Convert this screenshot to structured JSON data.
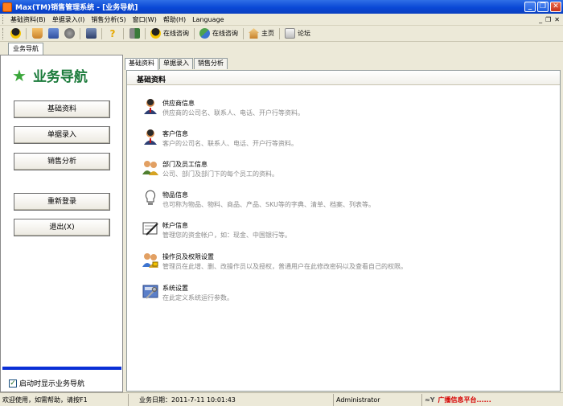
{
  "window": {
    "title": "Max(TM)销售管理系统 - [业务导航]"
  },
  "menu": {
    "items": [
      "基础资料(B)",
      "单据录入(I)",
      "销售分析(S)",
      "窗口(W)",
      "帮助(H)",
      "Language"
    ],
    "right_controls": [
      "_",
      "❐",
      "✕"
    ]
  },
  "toolbar": {
    "consult1": "在线咨询",
    "consult2": "在线咨询",
    "home": "主页",
    "forum": "论坛"
  },
  "doc_tab": "业务导航",
  "nav": {
    "title": "业务导航",
    "buttons": [
      "基础资料",
      "单据录入",
      "销售分析",
      "重新登录",
      "退出(X)"
    ],
    "startup_label": "启动时显示业务导航",
    "startup_checked": "✓"
  },
  "tabs": [
    "基础资料",
    "单据录入",
    "销售分析"
  ],
  "content": {
    "header": "基础资料",
    "entries": [
      {
        "title": "供应商信息",
        "desc": "供应商的公司名、联系人、电话、开户行等资料。",
        "icon": "supplier-person-icon"
      },
      {
        "title": "客户信息",
        "desc": "客户的公司名、联系人、电话、开户行等资料。",
        "icon": "customer-person-icon"
      },
      {
        "title": "部门及员工信息",
        "desc": "公司、部门及部门下的每个员工的资料。",
        "icon": "department-people-icon"
      },
      {
        "title": "物品信息",
        "desc": "也可称为物品、物料、商品、产品、SKU等的字典、清单、档案、列表等。",
        "icon": "lightbulb-icon"
      },
      {
        "title": "帐户信息",
        "desc": "管理您的资金帐户，如：现金、中国银行等。",
        "icon": "account-pen-icon"
      },
      {
        "title": "操作员及权限设置",
        "desc": "管理员在此增、删、改操作员以及授权，普通用户在此修改密码以及查看自己的权限。",
        "icon": "operators-icon"
      },
      {
        "title": "系统设置",
        "desc": "在此定义系统运行参数。",
        "icon": "tools-icon"
      }
    ]
  },
  "status": {
    "welcome": "欢迎使用，如需帮助，请按F1",
    "date_label": "业务日期：",
    "date_value": "2011-7-11 10:01:43",
    "user": "Administrator",
    "platform": "广播信息平台......"
  }
}
